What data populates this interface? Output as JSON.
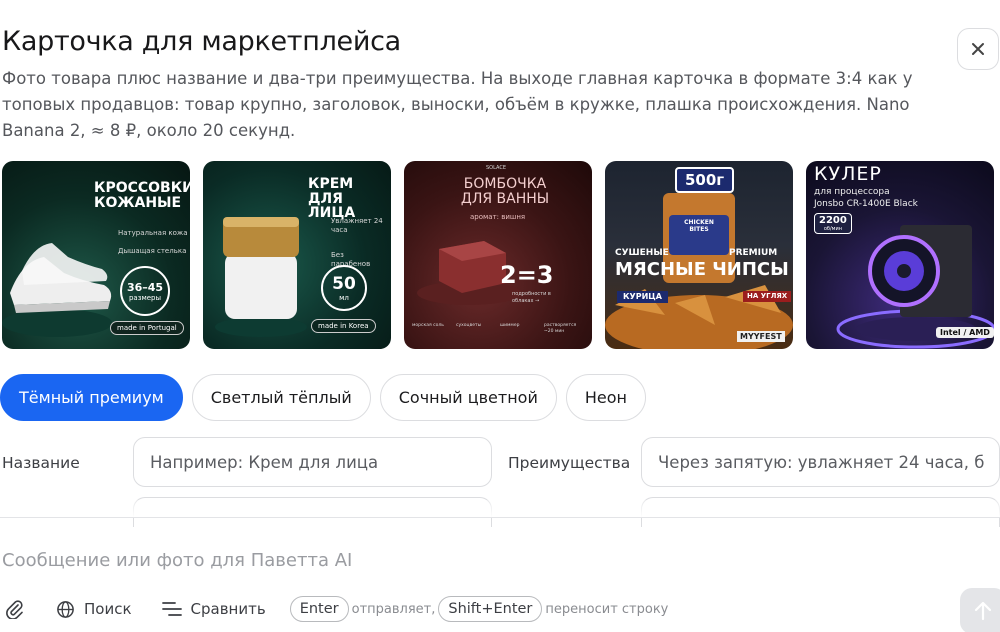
{
  "header": {
    "title": "Карточка для маркетплейса",
    "description": "Фото товара плюс название и два-три преимущества. На выходе главная карточка в формате 3:4 как у топовых продавцов: товар крупно, заголовок, выноски, объём в кружке, плашка происхождения. Nano Banana 2, ≈ 8 ₽, около 20 секунд.",
    "close_icon": "close-icon"
  },
  "examples": [
    {
      "title": "Кроссовки кожаные",
      "callouts": [
        "Натуральная кожа",
        "Дышащая стелька"
      ],
      "badge": "36–45",
      "badge_sub": "размеры",
      "origin": "made in Portugal"
    },
    {
      "title": "Крем для лица",
      "callouts": [
        "Увлажняет 24 часа",
        "Без парабенов"
      ],
      "badge": "50",
      "badge_sub": "мл",
      "origin": "made in Korea"
    },
    {
      "brand": "SOLACE",
      "title": "Бомбочка для ванны",
      "subtitle": "аромат: вишня",
      "badge": "2=3",
      "note": "подробности в облаках →",
      "footer": [
        "морская соль",
        "сухоцветы",
        "шиммер",
        "растворяется ~20 мин"
      ]
    },
    {
      "badge": "500г",
      "tag_left": "Сушеные",
      "tag_right": "Premium",
      "title": "Мясные чипсы",
      "pack": "CHICKEN BITES",
      "flavor": "Курица",
      "flavor_note": "На углях",
      "brand": "MYYFEST"
    },
    {
      "title": "Кулер",
      "subtitle": "для процессора",
      "model": "Jonsbo CR-1400E Black",
      "badge": "2200",
      "badge_sub": "об/мин",
      "platform": "Intel / AMD"
    }
  ],
  "styles": {
    "items": [
      "Тёмный премиум",
      "Светлый тёплый",
      "Сочный цветной",
      "Неон"
    ],
    "selected": "Тёмный премиум"
  },
  "form": {
    "name_label": "Название",
    "name_placeholder": "Например: Крем для лица",
    "benefits_label": "Преимущества",
    "benefits_placeholder": "Через запятую: увлажняет 24 часа, б"
  },
  "composer": {
    "placeholder": "Сообщение или фото для Паветта AI",
    "attach_icon": "paperclip-icon",
    "search_label": "Поиск",
    "compare_label": "Сравнить",
    "enter_key": "Enter",
    "enter_hint": "отправляет,",
    "shift_key": "Shift+Enter",
    "shift_hint": "переносит строку",
    "send_icon": "arrow-up-icon"
  },
  "colors": {
    "accent": "#1a66f2",
    "text": "#18181a",
    "muted": "#55575c",
    "border": "#dcdde0"
  }
}
